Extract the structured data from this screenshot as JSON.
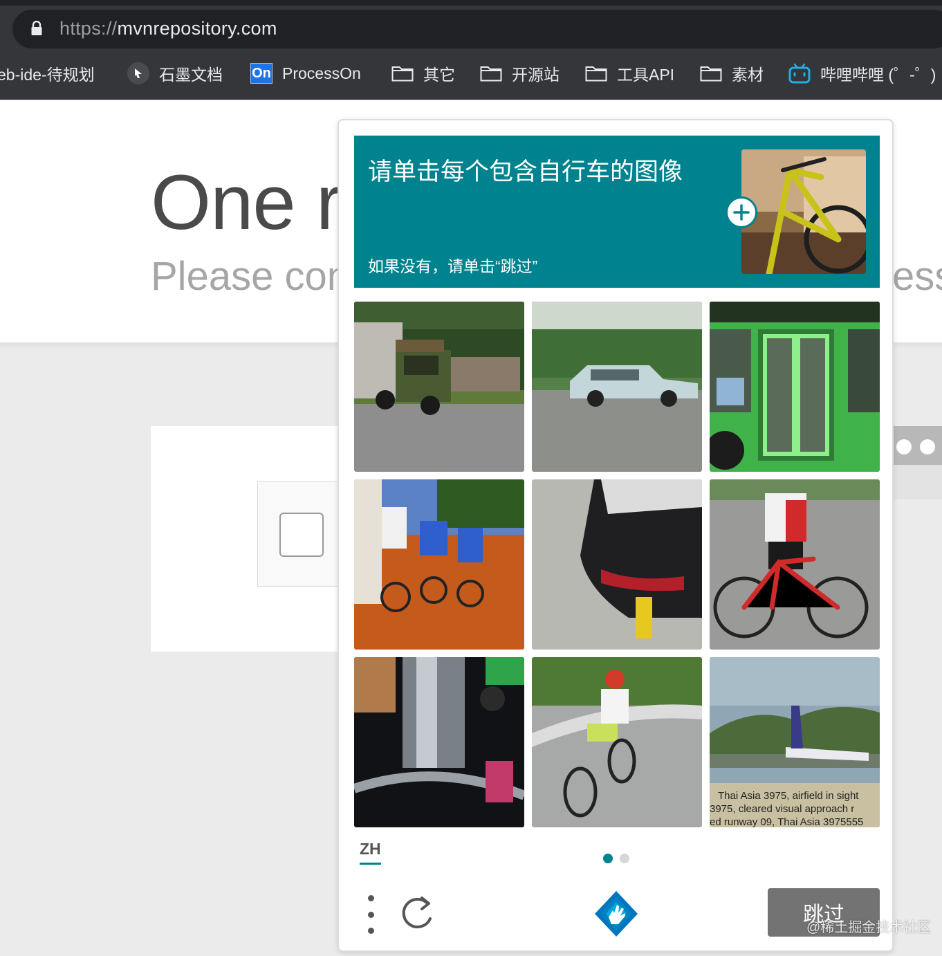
{
  "browser": {
    "url_scheme": "https://",
    "url_host": "mvnrepository.com",
    "bookmarks": [
      {
        "label": "eb-ide-待规划",
        "icon": "none"
      },
      {
        "label": "石墨文档",
        "icon": "shimo-icon"
      },
      {
        "label": "ProcessOn",
        "icon": "processon-icon",
        "icon_text": "On"
      },
      {
        "label": "其它",
        "icon": "folder-icon"
      },
      {
        "label": "开源站",
        "icon": "folder-icon"
      },
      {
        "label": "工具API",
        "icon": "folder-icon"
      },
      {
        "label": "素材",
        "icon": "folder-icon"
      },
      {
        "label": "哔哩哔哩 (゜-゜)",
        "icon": "bilibili-icon"
      }
    ]
  },
  "page": {
    "headline": "One r",
    "subline_left": "Please com",
    "subline_right": "ess"
  },
  "captcha": {
    "prompt_title": "请单击每个包含自行车的图像",
    "prompt_sub": "如果没有，请单击“跳过”",
    "example_image": "bicycle-example",
    "tiles": [
      {
        "subject": "garbage-truck"
      },
      {
        "subject": "station-wagon"
      },
      {
        "subject": "green-bus"
      },
      {
        "subject": "cyclists-on-dirt-road"
      },
      {
        "subject": "car-tail-light"
      },
      {
        "subject": "road-cyclist"
      },
      {
        "subject": "bicycle-part-closeup"
      },
      {
        "subject": "child-cycling"
      },
      {
        "subject": "airplane",
        "caption_lines": [
          "Thai Asia 3975, airfield in sight",
          "3975, cleared visual approach r",
          "ed runway 09, Thai Asia 3975555"
        ]
      }
    ],
    "language": "ZH",
    "skip_label": "跳过",
    "colors": {
      "accent": "#00838f",
      "skip_bg": "#737373"
    }
  },
  "watermark": "@稀土掘金技术社区"
}
